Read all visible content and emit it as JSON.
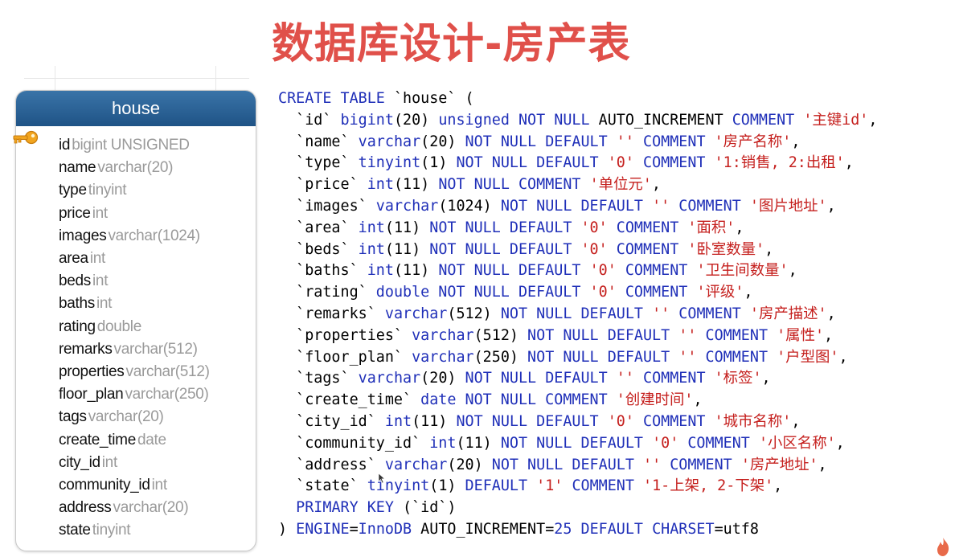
{
  "slide": {
    "title": "数据库设计-房产表"
  },
  "entity": {
    "name": "house",
    "fields": [
      {
        "name": "id",
        "type": "bigint UNSIGNED",
        "primary_key": true
      },
      {
        "name": "name",
        "type": "varchar(20)"
      },
      {
        "name": "type",
        "type": "tinyint"
      },
      {
        "name": "price",
        "type": "int"
      },
      {
        "name": "images",
        "type": "varchar(1024)"
      },
      {
        "name": "area",
        "type": "int"
      },
      {
        "name": "beds",
        "type": "int"
      },
      {
        "name": "baths",
        "type": "int"
      },
      {
        "name": "rating",
        "type": "double"
      },
      {
        "name": "remarks",
        "type": "varchar(512)"
      },
      {
        "name": "properties",
        "type": "varchar(512)"
      },
      {
        "name": "floor_plan",
        "type": "varchar(250)"
      },
      {
        "name": "tags",
        "type": "varchar(20)"
      },
      {
        "name": "create_time",
        "type": "date"
      },
      {
        "name": "city_id",
        "type": "int"
      },
      {
        "name": "community_id",
        "type": "int"
      },
      {
        "name": "address",
        "type": "varchar(20)"
      },
      {
        "name": "state",
        "type": "tinyint"
      }
    ]
  },
  "sql": {
    "lines": [
      [
        [
          "CREATE TABLE",
          "kw"
        ],
        [
          " `house` (",
          ""
        ]
      ],
      [
        [
          "  `id` ",
          ""
        ],
        [
          "bigint",
          "kw"
        ],
        [
          "(20) ",
          ""
        ],
        [
          "unsigned NOT NULL",
          "kw"
        ],
        [
          " AUTO_INCREMENT ",
          ""
        ],
        [
          "COMMENT",
          "kw"
        ],
        [
          " ",
          ""
        ],
        [
          "'主键id'",
          "str"
        ],
        [
          ",",
          ""
        ]
      ],
      [
        [
          "  `name` ",
          ""
        ],
        [
          "varchar",
          "kw"
        ],
        [
          "(20) ",
          ""
        ],
        [
          "NOT NULL DEFAULT",
          "kw"
        ],
        [
          " ",
          ""
        ],
        [
          "''",
          "str"
        ],
        [
          " ",
          ""
        ],
        [
          "COMMENT",
          "kw"
        ],
        [
          " ",
          ""
        ],
        [
          "'房产名称'",
          "str"
        ],
        [
          ",",
          ""
        ]
      ],
      [
        [
          "  `type` ",
          ""
        ],
        [
          "tinyint",
          "kw"
        ],
        [
          "(1) ",
          ""
        ],
        [
          "NOT NULL DEFAULT",
          "kw"
        ],
        [
          " ",
          ""
        ],
        [
          "'0'",
          "str"
        ],
        [
          " ",
          ""
        ],
        [
          "COMMENT",
          "kw"
        ],
        [
          " ",
          ""
        ],
        [
          "'1:销售, 2:出租'",
          "str"
        ],
        [
          ",",
          ""
        ]
      ],
      [
        [
          "  `price` ",
          ""
        ],
        [
          "int",
          "kw"
        ],
        [
          "(11) ",
          ""
        ],
        [
          "NOT NULL COMMENT",
          "kw"
        ],
        [
          " ",
          ""
        ],
        [
          "'单位元'",
          "str"
        ],
        [
          ",",
          ""
        ]
      ],
      [
        [
          "  `images` ",
          ""
        ],
        [
          "varchar",
          "kw"
        ],
        [
          "(1024) ",
          ""
        ],
        [
          "NOT NULL DEFAULT",
          "kw"
        ],
        [
          " ",
          ""
        ],
        [
          "''",
          "str"
        ],
        [
          " ",
          ""
        ],
        [
          "COMMENT",
          "kw"
        ],
        [
          " ",
          ""
        ],
        [
          "'图片地址'",
          "str"
        ],
        [
          ",",
          ""
        ]
      ],
      [
        [
          "  `area` ",
          ""
        ],
        [
          "int",
          "kw"
        ],
        [
          "(11) ",
          ""
        ],
        [
          "NOT NULL DEFAULT",
          "kw"
        ],
        [
          " ",
          ""
        ],
        [
          "'0'",
          "str"
        ],
        [
          " ",
          ""
        ],
        [
          "COMMENT",
          "kw"
        ],
        [
          " ",
          ""
        ],
        [
          "'面积'",
          "str"
        ],
        [
          ",",
          ""
        ]
      ],
      [
        [
          "  `beds` ",
          ""
        ],
        [
          "int",
          "kw"
        ],
        [
          "(11) ",
          ""
        ],
        [
          "NOT NULL DEFAULT",
          "kw"
        ],
        [
          " ",
          ""
        ],
        [
          "'0'",
          "str"
        ],
        [
          " ",
          ""
        ],
        [
          "COMMENT",
          "kw"
        ],
        [
          " ",
          ""
        ],
        [
          "'卧室数量'",
          "str"
        ],
        [
          ",",
          ""
        ]
      ],
      [
        [
          "  `baths` ",
          ""
        ],
        [
          "int",
          "kw"
        ],
        [
          "(11) ",
          ""
        ],
        [
          "NOT NULL DEFAULT",
          "kw"
        ],
        [
          " ",
          ""
        ],
        [
          "'0'",
          "str"
        ],
        [
          " ",
          ""
        ],
        [
          "COMMENT",
          "kw"
        ],
        [
          " ",
          ""
        ],
        [
          "'卫生间数量'",
          "str"
        ],
        [
          ",",
          ""
        ]
      ],
      [
        [
          "  `rating` ",
          ""
        ],
        [
          "double NOT NULL DEFAULT",
          "kw"
        ],
        [
          " ",
          ""
        ],
        [
          "'0'",
          "str"
        ],
        [
          " ",
          ""
        ],
        [
          "COMMENT",
          "kw"
        ],
        [
          " ",
          ""
        ],
        [
          "'评级'",
          "str"
        ],
        [
          ",",
          ""
        ]
      ],
      [
        [
          "  `remarks` ",
          ""
        ],
        [
          "varchar",
          "kw"
        ],
        [
          "(512) ",
          ""
        ],
        [
          "NOT NULL DEFAULT",
          "kw"
        ],
        [
          " ",
          ""
        ],
        [
          "''",
          "str"
        ],
        [
          " ",
          ""
        ],
        [
          "COMMENT",
          "kw"
        ],
        [
          " ",
          ""
        ],
        [
          "'房产描述'",
          "str"
        ],
        [
          ",",
          ""
        ]
      ],
      [
        [
          "  `properties` ",
          ""
        ],
        [
          "varchar",
          "kw"
        ],
        [
          "(512) ",
          ""
        ],
        [
          "NOT NULL DEFAULT",
          "kw"
        ],
        [
          " ",
          ""
        ],
        [
          "''",
          "str"
        ],
        [
          " ",
          ""
        ],
        [
          "COMMENT",
          "kw"
        ],
        [
          " ",
          ""
        ],
        [
          "'属性'",
          "str"
        ],
        [
          ",",
          ""
        ]
      ],
      [
        [
          "  `floor_plan` ",
          ""
        ],
        [
          "varchar",
          "kw"
        ],
        [
          "(250) ",
          ""
        ],
        [
          "NOT NULL DEFAULT",
          "kw"
        ],
        [
          " ",
          ""
        ],
        [
          "''",
          "str"
        ],
        [
          " ",
          ""
        ],
        [
          "COMMENT",
          "kw"
        ],
        [
          " ",
          ""
        ],
        [
          "'户型图'",
          "str"
        ],
        [
          ",",
          ""
        ]
      ],
      [
        [
          "  `tags` ",
          ""
        ],
        [
          "varchar",
          "kw"
        ],
        [
          "(20) ",
          ""
        ],
        [
          "NOT NULL DEFAULT",
          "kw"
        ],
        [
          " ",
          ""
        ],
        [
          "''",
          "str"
        ],
        [
          " ",
          ""
        ],
        [
          "COMMENT",
          "kw"
        ],
        [
          " ",
          ""
        ],
        [
          "'标签'",
          "str"
        ],
        [
          ",",
          ""
        ]
      ],
      [
        [
          "  `create_time` ",
          ""
        ],
        [
          "date NOT NULL COMMENT",
          "kw"
        ],
        [
          " ",
          ""
        ],
        [
          "'创建时间'",
          "str"
        ],
        [
          ",",
          ""
        ]
      ],
      [
        [
          "  `city_id` ",
          ""
        ],
        [
          "int",
          "kw"
        ],
        [
          "(11) ",
          ""
        ],
        [
          "NOT NULL DEFAULT",
          "kw"
        ],
        [
          " ",
          ""
        ],
        [
          "'0'",
          "str"
        ],
        [
          " ",
          ""
        ],
        [
          "COMMENT",
          "kw"
        ],
        [
          " ",
          ""
        ],
        [
          "'城市名称'",
          "str"
        ],
        [
          ",",
          ""
        ]
      ],
      [
        [
          "  `community_id` ",
          ""
        ],
        [
          "int",
          "kw"
        ],
        [
          "(11) ",
          ""
        ],
        [
          "NOT NULL DEFAULT",
          "kw"
        ],
        [
          " ",
          ""
        ],
        [
          "'0'",
          "str"
        ],
        [
          " ",
          ""
        ],
        [
          "COMMENT",
          "kw"
        ],
        [
          " ",
          ""
        ],
        [
          "'小区名称'",
          "str"
        ],
        [
          ",",
          ""
        ]
      ],
      [
        [
          "  `address` ",
          ""
        ],
        [
          "varchar",
          "kw"
        ],
        [
          "(20) ",
          ""
        ],
        [
          "NOT NULL DEFAULT",
          "kw"
        ],
        [
          " ",
          ""
        ],
        [
          "''",
          "str"
        ],
        [
          " ",
          ""
        ],
        [
          "COMMENT",
          "kw"
        ],
        [
          " ",
          ""
        ],
        [
          "'房产地址'",
          "str"
        ],
        [
          ",",
          ""
        ]
      ],
      [
        [
          "  `state` ",
          ""
        ],
        [
          "tinyint",
          "kw"
        ],
        [
          "(1) ",
          ""
        ],
        [
          "DEFAULT",
          "kw"
        ],
        [
          " ",
          ""
        ],
        [
          "'1'",
          "str"
        ],
        [
          " ",
          ""
        ],
        [
          "COMMENT",
          "kw"
        ],
        [
          " ",
          ""
        ],
        [
          "'1-上架, 2-下架'",
          "str"
        ],
        [
          ",",
          ""
        ]
      ],
      [
        [
          "  ",
          ""
        ],
        [
          "PRIMARY KEY",
          "kw"
        ],
        [
          " (`id`)",
          ""
        ]
      ],
      [
        [
          ") ",
          ""
        ],
        [
          "ENGINE",
          "kw"
        ],
        [
          "=",
          ""
        ],
        [
          "InnoDB",
          "kw"
        ],
        [
          " AUTO_INCREMENT=",
          ""
        ],
        [
          "25",
          "kw"
        ],
        [
          " ",
          ""
        ],
        [
          "DEFAULT CHARSET",
          "kw"
        ],
        [
          "=utf8",
          ""
        ]
      ]
    ]
  },
  "colors": {
    "title": "#e0504a",
    "header_bar": "#1f5386",
    "keyword": "#1f2fb8",
    "string": "#c5201e",
    "field_type": "#9a9a9a",
    "key_icon": "#f0a020"
  },
  "icons": {
    "primary_key": "key-icon",
    "watermark": "flame-icon"
  }
}
